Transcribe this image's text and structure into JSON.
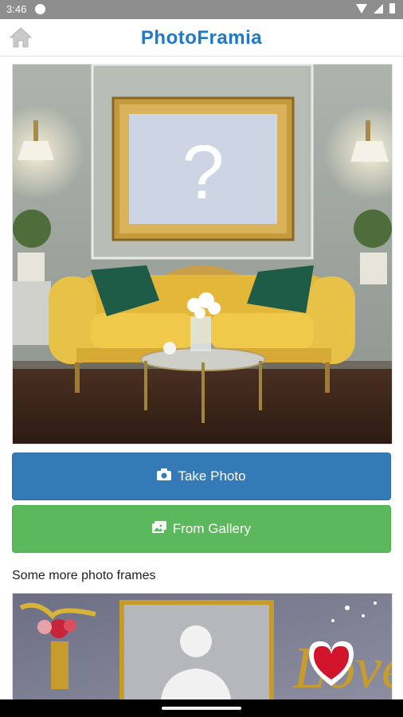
{
  "status_bar": {
    "time": "3:46"
  },
  "header": {
    "brand": "PhotoFramia",
    "home_icon": "home-icon"
  },
  "hero": {
    "placeholder_mark": "?",
    "frame_color": "#c49a3c",
    "sofa_color": "#e3b83a"
  },
  "actions": {
    "take_photo": {
      "label": "Take Photo",
      "icon": "camera-icon",
      "color": "#337ab7"
    },
    "from_gallery": {
      "label": "From Gallery",
      "icon": "images-icon",
      "color": "#5cb85c"
    }
  },
  "more_frames": {
    "title": "Some more photo frames",
    "items": [
      {
        "name": "love-frame",
        "text": "Love"
      }
    ]
  }
}
